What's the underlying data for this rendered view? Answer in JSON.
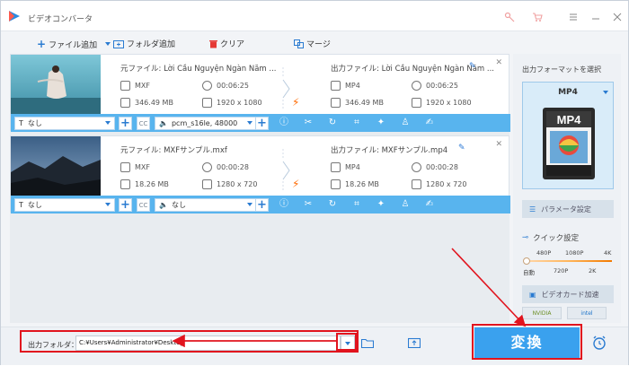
{
  "app": {
    "title": "ビデオコンバータ"
  },
  "toolbar": {
    "add_file": "ファイル追加",
    "add_folder": "フォルダ追加",
    "clear": "クリア",
    "merge": "マージ"
  },
  "files": [
    {
      "source_name": "元ファイル: Lời Cầu Nguyện Ngàn Năm ...",
      "output_name": "出力ファイル: Lời Cầu Nguyện Ngàn Năm ...",
      "src_format": "MXF",
      "src_duration": "00:06:25",
      "src_size": "346.49 MB",
      "src_resolution": "1920 x 1080",
      "out_format": "MP4",
      "out_duration": "00:06:25",
      "out_size": "346.49 MB",
      "out_resolution": "1920 x 1080",
      "subtitle": "なし",
      "audio": "pcm_s16le, 48000"
    },
    {
      "source_name": "元ファイル: MXFサンプル.mxf",
      "output_name": "出力ファイル: MXFサンプル.mp4",
      "src_format": "MXF",
      "src_duration": "00:00:28",
      "src_size": "18.26 MB",
      "src_resolution": "1280 x 720",
      "out_format": "MP4",
      "out_duration": "00:00:28",
      "out_size": "18.26 MB",
      "out_resolution": "1280 x 720",
      "subtitle": "なし",
      "audio": "なし"
    }
  ],
  "right_panel": {
    "title": "出力フォーマットを選択",
    "format": "MP4",
    "format_badge": "MP4",
    "param_settings": "パラメータ設定",
    "quick_settings": "クイック設定",
    "slider_top": [
      "480P",
      "1080P",
      "4K"
    ],
    "slider_bottom": [
      "自動",
      "720P",
      "2K"
    ],
    "gpu_accel": "ビデオカード加速",
    "gpu_brands": [
      "NVIDIA",
      "intel"
    ]
  },
  "bottom": {
    "output_label": "出力フォルダ：",
    "output_path": "C:¥Users¥Administrator¥Desktop",
    "convert_label": "変換"
  },
  "colors": {
    "accent": "#3aa1ee",
    "highlight": "#e1141e",
    "bolt": "#ff6a00"
  }
}
